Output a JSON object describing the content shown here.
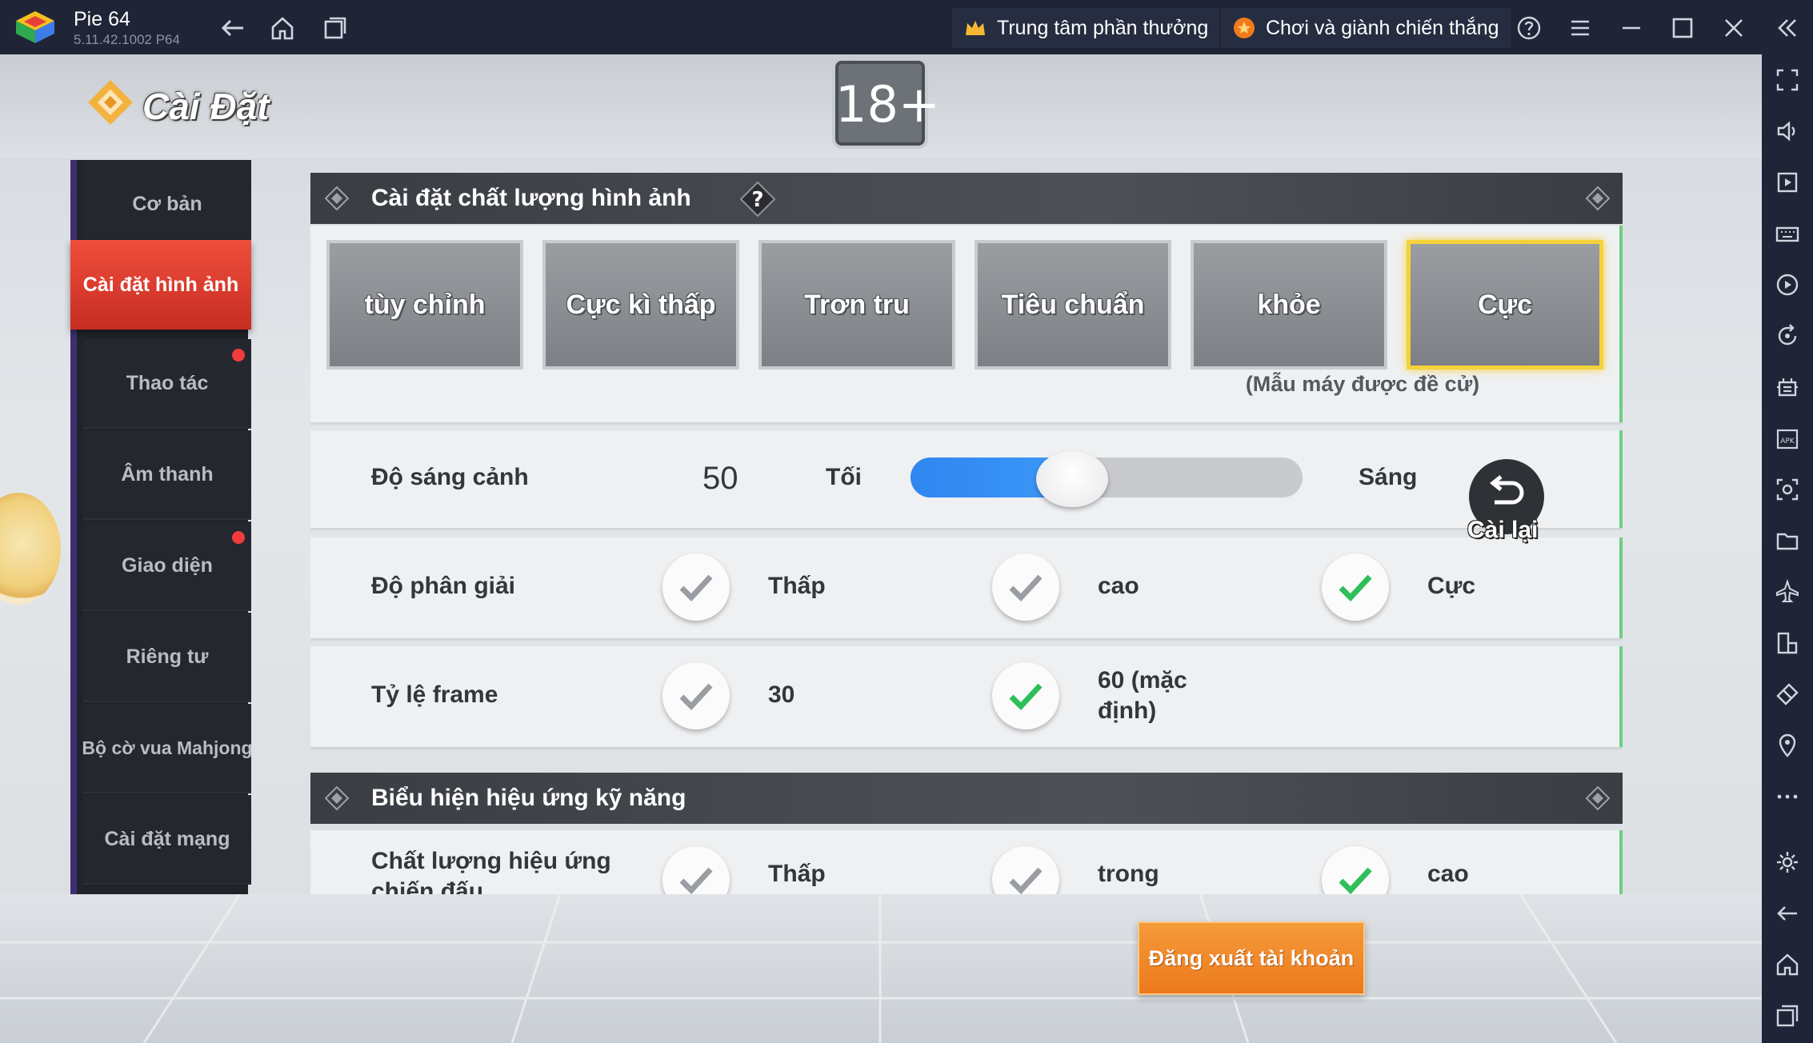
{
  "emulator": {
    "app_name": "Pie 64",
    "app_version": "5.11.42.1002  P64",
    "rewards_label": "Trung tâm phần thưởng",
    "play_win_label": "Chơi và giành chiến thắng",
    "icons": [
      "back-icon",
      "home-icon",
      "recents-icon",
      "help-icon",
      "menu-icon",
      "minimize-icon",
      "maximize-icon",
      "close-icon",
      "collapse-sidebar-icon"
    ],
    "sidebar_icons": [
      "fullscreen-icon",
      "volume-icon",
      "media-icon",
      "keyboard-icon",
      "record-icon",
      "rotate-icon",
      "performance-icon",
      "apk-icon",
      "screenshot-icon",
      "folder-icon",
      "airplane-icon",
      "multi-instance-icon",
      "eraser-icon",
      "location-icon",
      "more-icon",
      "settings-icon",
      "back-icon",
      "home-icon",
      "recents-icon"
    ]
  },
  "game": {
    "page_title": "Cài Đặt",
    "age_rating": "18+",
    "tabs": [
      {
        "label": "Cơ bản",
        "active": false,
        "dot": false
      },
      {
        "label": "Cài đặt hình ảnh",
        "active": true,
        "dot": false
      },
      {
        "label": "Thao tác",
        "active": false,
        "dot": true
      },
      {
        "label": "Âm thanh",
        "active": false,
        "dot": false
      },
      {
        "label": "Giao diện",
        "active": false,
        "dot": true
      },
      {
        "label": "Riêng tư",
        "active": false,
        "dot": false
      },
      {
        "label": "Bộ cờ vua Mahjong",
        "active": false,
        "dot": false
      },
      {
        "label": "Cài đặt mạng",
        "active": false,
        "dot": false
      }
    ],
    "image_quality": {
      "header": "Cài đặt chất lượng hình ảnh",
      "presets": [
        "tùy chỉnh",
        "Cực kì thấp",
        "Trơn tru",
        "Tiêu chuẩn",
        "khỏe",
        "Cực"
      ],
      "selected": "Cực",
      "recommended_note": "(Mẫu máy được đề cử)"
    },
    "brightness": {
      "label": "Độ sáng cảnh",
      "value": "50",
      "value_fraction": 0.35,
      "min_label": "Tối",
      "max_label": "Sáng",
      "reset_label": "Cài lại"
    },
    "resolution": {
      "label": "Độ phân giải",
      "options": [
        "Thấp",
        "cao",
        "Cực"
      ],
      "selected": "Cực"
    },
    "frame_rate": {
      "label": "Tỷ lệ frame",
      "options": [
        "30",
        "60 (mặc\nđịnh)"
      ],
      "selected": "60 (mặc\nđịnh)"
    },
    "skill_effects": {
      "header": "Biểu hiện hiệu ứng kỹ năng",
      "quality_label": "Chất lượng hiệu ứng chiến đấu",
      "options": [
        "Thấp",
        "trong",
        "cao"
      ],
      "selected": "cao"
    },
    "logout_label": "Đăng xuất tài khoản",
    "colors": {
      "accent_tab": "#e63f31",
      "selected_border": "#f6d23a",
      "check_green": "#2fbf5a",
      "check_grey": "#9a9da2",
      "slider_fill": "#2f86f0",
      "logout": "#ef8527"
    }
  }
}
